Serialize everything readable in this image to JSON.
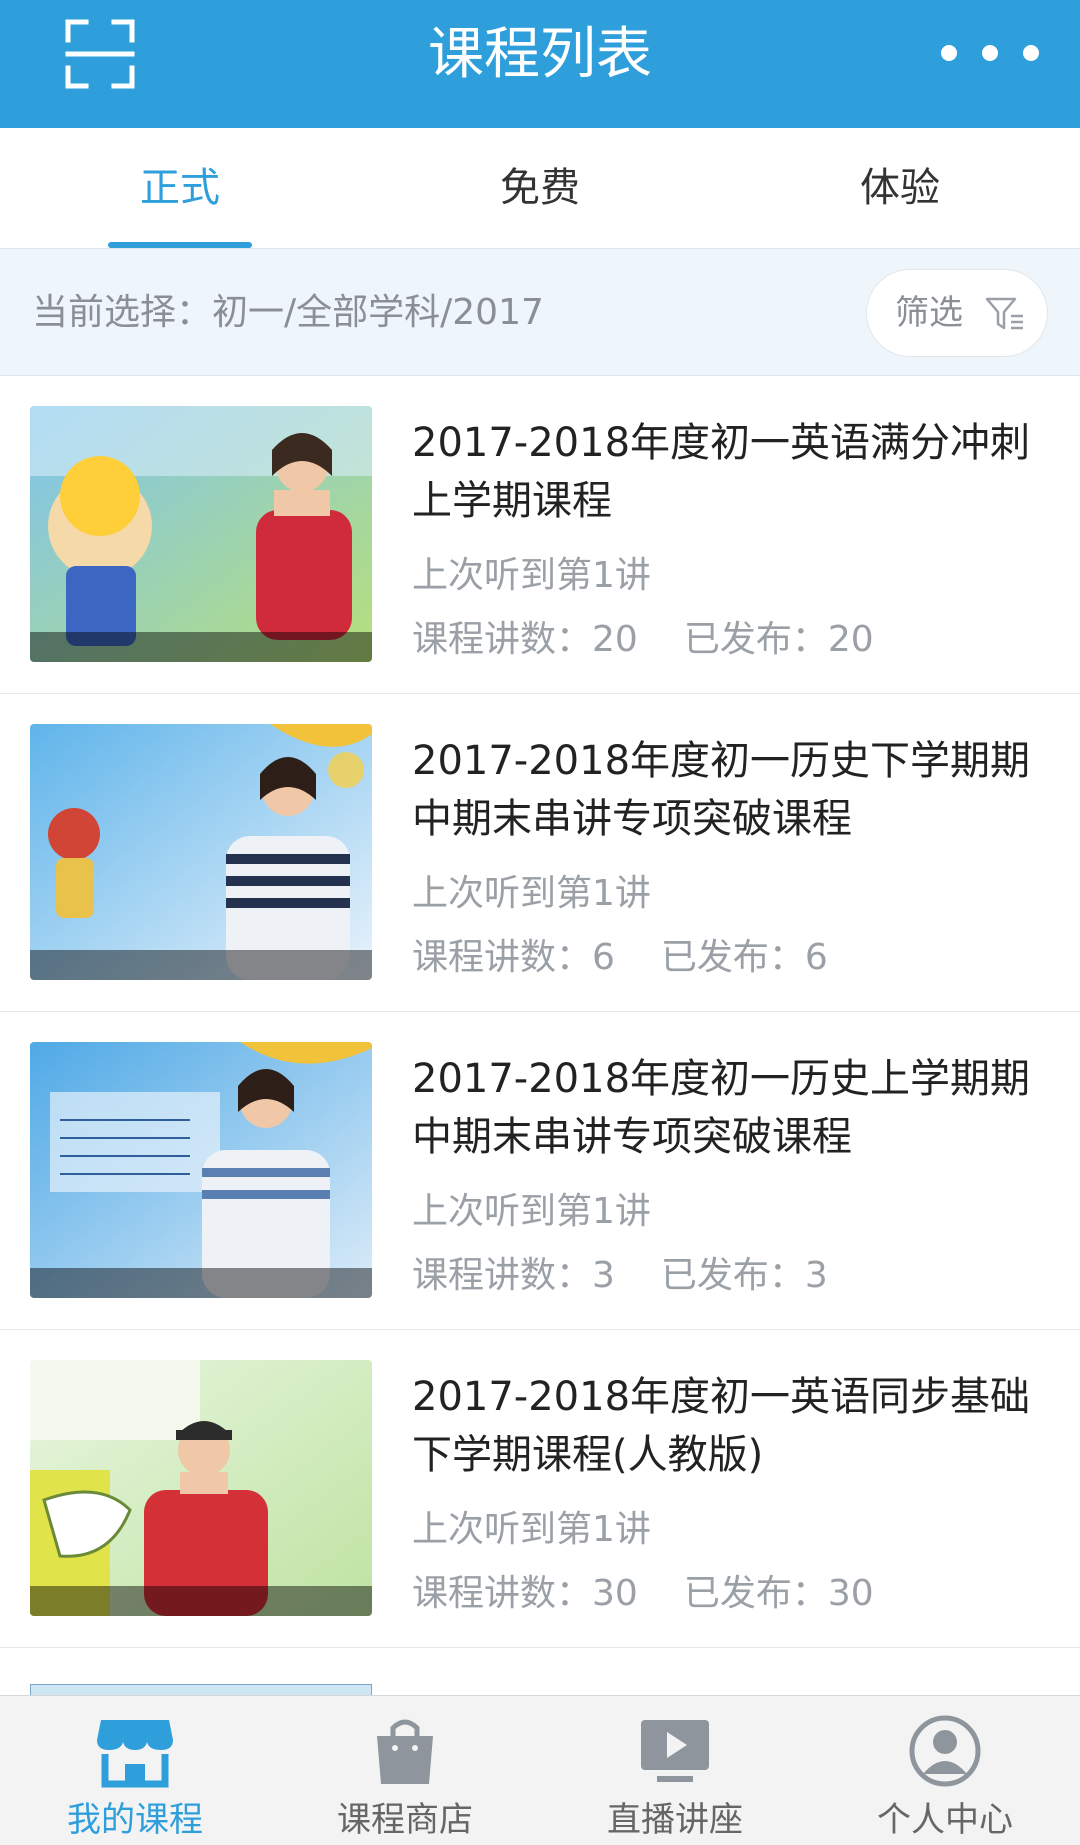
{
  "header": {
    "title": "课程列表",
    "left_icon": "scan-icon",
    "right_icon": "more-icon"
  },
  "tabs": [
    {
      "label": "正式",
      "active": true
    },
    {
      "label": "免费",
      "active": false
    },
    {
      "label": "体验",
      "active": false
    }
  ],
  "filter": {
    "current_label": "当前选择：初一/全部学科/2017",
    "button_label": "筛选",
    "button_icon": "funnel-icon"
  },
  "courses": [
    {
      "title": "2017-2018年度初一英语满分冲刺上学期课程",
      "last_listened": "上次听到第1讲",
      "lecture_count_label": "课程讲数：20",
      "published_label": "已发布：20"
    },
    {
      "title": "2017-2018年度初一历史下学期期中期末串讲专项突破课程",
      "last_listened": "上次听到第1讲",
      "lecture_count_label": "课程讲数：6",
      "published_label": "已发布：6"
    },
    {
      "title": "2017-2018年度初一历史上学期期中期末串讲专项突破课程",
      "last_listened": "上次听到第1讲",
      "lecture_count_label": "课程讲数：3",
      "published_label": "已发布：3"
    },
    {
      "title": "2017-2018年度初一英语同步基础下学期课程(人教版)",
      "last_listened": "上次听到第1讲",
      "lecture_count_label": "课程讲数：30",
      "published_label": "已发布：30"
    }
  ],
  "bottom_nav": [
    {
      "label": "我的课程",
      "icon": "store-icon",
      "active": true
    },
    {
      "label": "课程商店",
      "icon": "shopping-bag-icon",
      "active": false
    },
    {
      "label": "直播讲座",
      "icon": "play-screen-icon",
      "active": false
    },
    {
      "label": "个人中心",
      "icon": "user-icon",
      "active": false
    }
  ],
  "colors": {
    "accent": "#2f9fdc",
    "muted_text": "#9aa0a6",
    "filter_bg": "#eef6fc"
  }
}
